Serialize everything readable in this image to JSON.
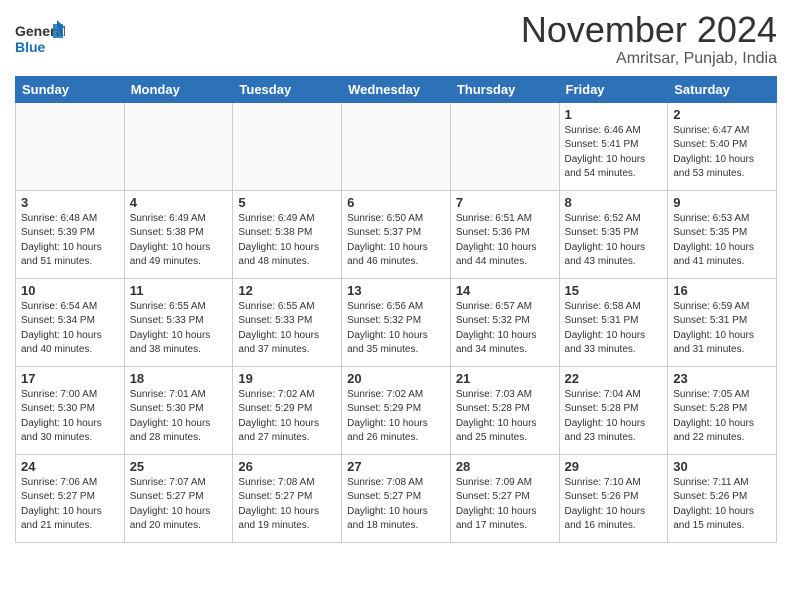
{
  "header": {
    "logo_general": "General",
    "logo_blue": "Blue",
    "month": "November 2024",
    "location": "Amritsar, Punjab, India"
  },
  "weekdays": [
    "Sunday",
    "Monday",
    "Tuesday",
    "Wednesday",
    "Thursday",
    "Friday",
    "Saturday"
  ],
  "weeks": [
    [
      {
        "day": "",
        "info": ""
      },
      {
        "day": "",
        "info": ""
      },
      {
        "day": "",
        "info": ""
      },
      {
        "day": "",
        "info": ""
      },
      {
        "day": "",
        "info": ""
      },
      {
        "day": "1",
        "info": "Sunrise: 6:46 AM\nSunset: 5:41 PM\nDaylight: 10 hours and 54 minutes."
      },
      {
        "day": "2",
        "info": "Sunrise: 6:47 AM\nSunset: 5:40 PM\nDaylight: 10 hours and 53 minutes."
      }
    ],
    [
      {
        "day": "3",
        "info": "Sunrise: 6:48 AM\nSunset: 5:39 PM\nDaylight: 10 hours and 51 minutes."
      },
      {
        "day": "4",
        "info": "Sunrise: 6:49 AM\nSunset: 5:38 PM\nDaylight: 10 hours and 49 minutes."
      },
      {
        "day": "5",
        "info": "Sunrise: 6:49 AM\nSunset: 5:38 PM\nDaylight: 10 hours and 48 minutes."
      },
      {
        "day": "6",
        "info": "Sunrise: 6:50 AM\nSunset: 5:37 PM\nDaylight: 10 hours and 46 minutes."
      },
      {
        "day": "7",
        "info": "Sunrise: 6:51 AM\nSunset: 5:36 PM\nDaylight: 10 hours and 44 minutes."
      },
      {
        "day": "8",
        "info": "Sunrise: 6:52 AM\nSunset: 5:35 PM\nDaylight: 10 hours and 43 minutes."
      },
      {
        "day": "9",
        "info": "Sunrise: 6:53 AM\nSunset: 5:35 PM\nDaylight: 10 hours and 41 minutes."
      }
    ],
    [
      {
        "day": "10",
        "info": "Sunrise: 6:54 AM\nSunset: 5:34 PM\nDaylight: 10 hours and 40 minutes."
      },
      {
        "day": "11",
        "info": "Sunrise: 6:55 AM\nSunset: 5:33 PM\nDaylight: 10 hours and 38 minutes."
      },
      {
        "day": "12",
        "info": "Sunrise: 6:55 AM\nSunset: 5:33 PM\nDaylight: 10 hours and 37 minutes."
      },
      {
        "day": "13",
        "info": "Sunrise: 6:56 AM\nSunset: 5:32 PM\nDaylight: 10 hours and 35 minutes."
      },
      {
        "day": "14",
        "info": "Sunrise: 6:57 AM\nSunset: 5:32 PM\nDaylight: 10 hours and 34 minutes."
      },
      {
        "day": "15",
        "info": "Sunrise: 6:58 AM\nSunset: 5:31 PM\nDaylight: 10 hours and 33 minutes."
      },
      {
        "day": "16",
        "info": "Sunrise: 6:59 AM\nSunset: 5:31 PM\nDaylight: 10 hours and 31 minutes."
      }
    ],
    [
      {
        "day": "17",
        "info": "Sunrise: 7:00 AM\nSunset: 5:30 PM\nDaylight: 10 hours and 30 minutes."
      },
      {
        "day": "18",
        "info": "Sunrise: 7:01 AM\nSunset: 5:30 PM\nDaylight: 10 hours and 28 minutes."
      },
      {
        "day": "19",
        "info": "Sunrise: 7:02 AM\nSunset: 5:29 PM\nDaylight: 10 hours and 27 minutes."
      },
      {
        "day": "20",
        "info": "Sunrise: 7:02 AM\nSunset: 5:29 PM\nDaylight: 10 hours and 26 minutes."
      },
      {
        "day": "21",
        "info": "Sunrise: 7:03 AM\nSunset: 5:28 PM\nDaylight: 10 hours and 25 minutes."
      },
      {
        "day": "22",
        "info": "Sunrise: 7:04 AM\nSunset: 5:28 PM\nDaylight: 10 hours and 23 minutes."
      },
      {
        "day": "23",
        "info": "Sunrise: 7:05 AM\nSunset: 5:28 PM\nDaylight: 10 hours and 22 minutes."
      }
    ],
    [
      {
        "day": "24",
        "info": "Sunrise: 7:06 AM\nSunset: 5:27 PM\nDaylight: 10 hours and 21 minutes."
      },
      {
        "day": "25",
        "info": "Sunrise: 7:07 AM\nSunset: 5:27 PM\nDaylight: 10 hours and 20 minutes."
      },
      {
        "day": "26",
        "info": "Sunrise: 7:08 AM\nSunset: 5:27 PM\nDaylight: 10 hours and 19 minutes."
      },
      {
        "day": "27",
        "info": "Sunrise: 7:08 AM\nSunset: 5:27 PM\nDaylight: 10 hours and 18 minutes."
      },
      {
        "day": "28",
        "info": "Sunrise: 7:09 AM\nSunset: 5:27 PM\nDaylight: 10 hours and 17 minutes."
      },
      {
        "day": "29",
        "info": "Sunrise: 7:10 AM\nSunset: 5:26 PM\nDaylight: 10 hours and 16 minutes."
      },
      {
        "day": "30",
        "info": "Sunrise: 7:11 AM\nSunset: 5:26 PM\nDaylight: 10 hours and 15 minutes."
      }
    ]
  ]
}
